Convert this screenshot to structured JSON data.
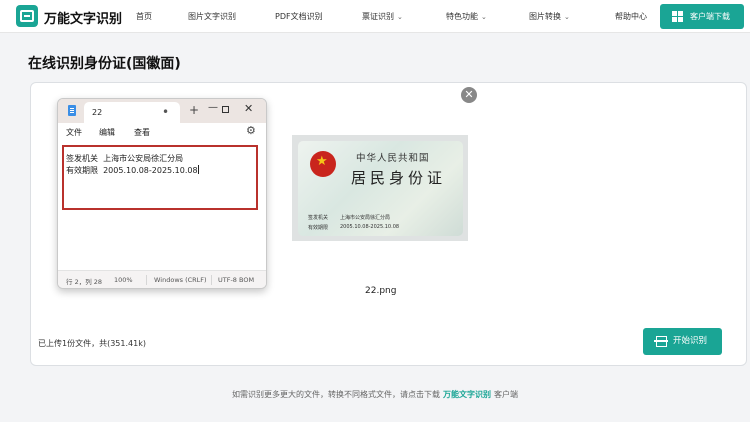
{
  "header": {
    "logo": "万能文字识别",
    "nav": [
      {
        "label": "首页",
        "dropdown": false
      },
      {
        "label": "图片文字识别",
        "dropdown": false
      },
      {
        "label": "PDF文档识别",
        "dropdown": false
      },
      {
        "label": "票证识别",
        "dropdown": true
      },
      {
        "label": "特色功能",
        "dropdown": true
      },
      {
        "label": "图片转换",
        "dropdown": true
      },
      {
        "label": "帮助中心",
        "dropdown": false
      }
    ],
    "download_button": "客户端下载"
  },
  "page_title": "在线识别身份证(国徽面)",
  "notepad": {
    "tab_name": "22",
    "menu": [
      "文件",
      "编辑",
      "查看"
    ],
    "line1": "签发机关  上海市公安局徐汇分局",
    "line2": "有效期限  2005.10.08-2025.10.08",
    "status": {
      "position": "行 2，列 28",
      "zoom": "100%",
      "line_ending": "Windows (CRLF)",
      "encoding": "UTF-8 BOM"
    }
  },
  "image_card": {
    "header1": "中华人民共和国",
    "header2": "居民身份证",
    "issuer_label": "签发机关",
    "issuer_value": "上海市公安局徐汇分局",
    "validity_label": "有效期限",
    "validity_value": "2005.10.08-2025.10.08",
    "file_name": "22.png"
  },
  "upload_info": "已上传1份文件，共(351.41k)",
  "start_button": "开始识别",
  "footer": {
    "prefix": "如需识别更多更大的文件，转换不同格式文件，请点击下载",
    "brand": "万能文字识别",
    "suffix": "客户端"
  },
  "colors": {
    "accent": "#1aa595",
    "highlight": "#b9312c"
  }
}
